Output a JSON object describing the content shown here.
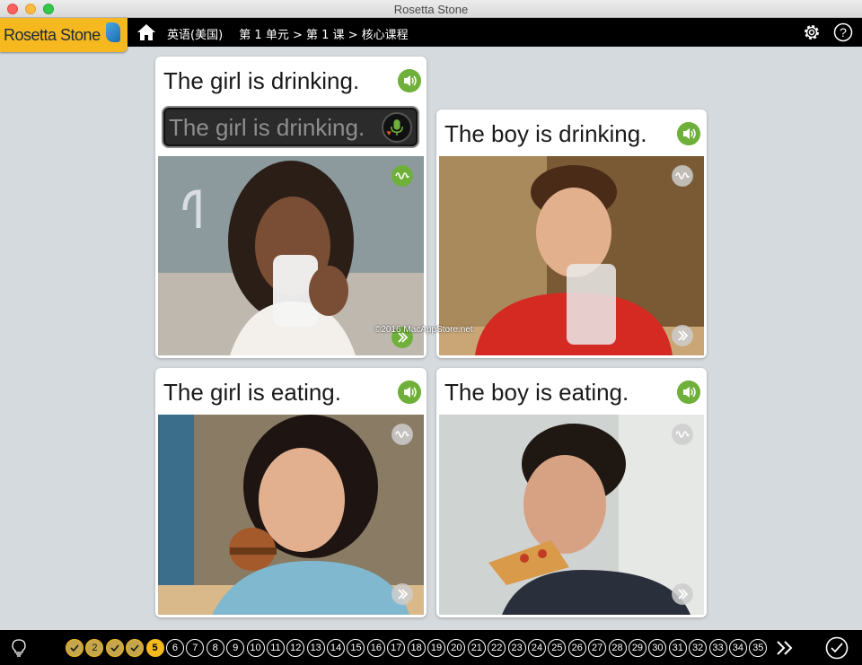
{
  "window": {
    "title": "Rosetta Stone"
  },
  "logo": {
    "text": "Rosetta Stone"
  },
  "breadcrumb": [
    "英语(美国)",
    "第 1 单元 > 第 1 课 > 核心课程"
  ],
  "cards": [
    {
      "caption": "The girl is drinking.",
      "speech_transcript": "The girl is drinking."
    },
    {
      "caption": "The boy is drinking."
    },
    {
      "caption": "The girl is eating."
    },
    {
      "caption": "The boy is eating."
    }
  ],
  "watermark": "©2016 MacAppStore.net",
  "progress": {
    "steps": [
      "",
      "2",
      "",
      "",
      "5",
      "6",
      "7",
      "8",
      "9",
      "10",
      "11",
      "12",
      "13",
      "14",
      "15",
      "16",
      "17",
      "18",
      "19",
      "20",
      "21",
      "22",
      "23",
      "24",
      "25",
      "26",
      "27",
      "28",
      "29",
      "30",
      "31",
      "32",
      "33",
      "34",
      "35"
    ],
    "completed": [
      1,
      3,
      4
    ],
    "visited": [
      2
    ],
    "current": 5
  },
  "colors": {
    "accent": "#f5b81e",
    "speaker_green": "#6fb03a"
  },
  "icons": [
    "home-icon",
    "gear-icon",
    "help-icon",
    "speaker-icon",
    "microphone-icon",
    "waveform-icon",
    "forward-icon",
    "lightbulb-icon",
    "check-icon"
  ]
}
